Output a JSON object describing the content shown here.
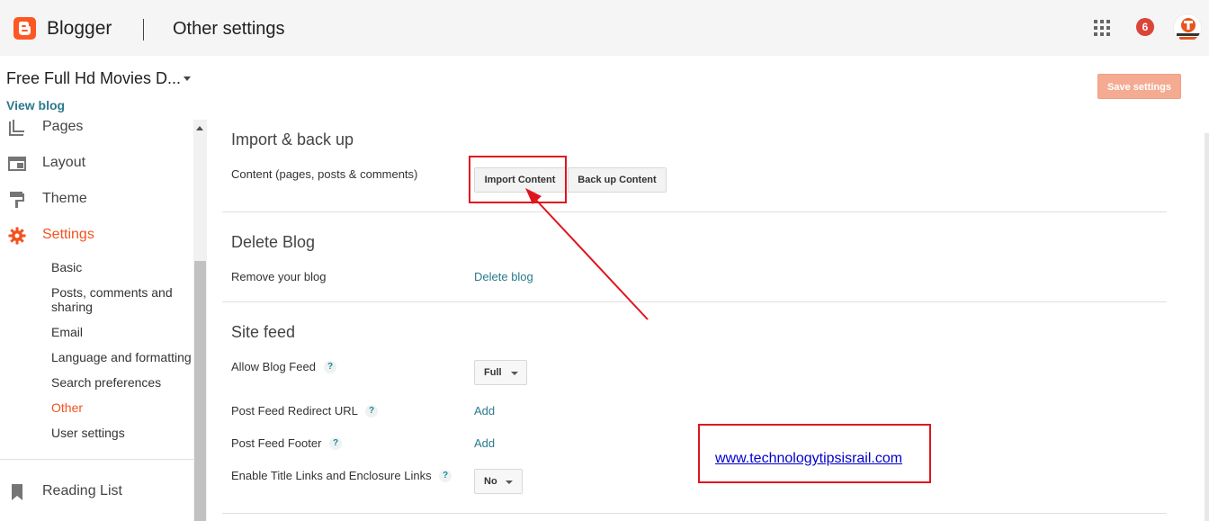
{
  "topbar": {
    "brand": "Blogger",
    "page_heading": "Other settings",
    "notification_count": "6"
  },
  "blog": {
    "title": "Free Full Hd Movies D...",
    "view_blog": "View blog"
  },
  "toolbar": {
    "save_label": "Save settings"
  },
  "sidebar": {
    "items": [
      {
        "label": "Pages",
        "icon": "pages-icon"
      },
      {
        "label": "Layout",
        "icon": "layout-icon"
      },
      {
        "label": "Theme",
        "icon": "theme-icon"
      },
      {
        "label": "Settings",
        "icon": "gear-icon",
        "active": true
      },
      {
        "label": "Reading List",
        "icon": "bookmark-icon"
      }
    ],
    "sub_items": [
      {
        "label": "Basic"
      },
      {
        "label": "Posts, comments and sharing"
      },
      {
        "label": "Email"
      },
      {
        "label": "Language and formatting"
      },
      {
        "label": "Search preferences"
      },
      {
        "label": "Other",
        "active": true
      },
      {
        "label": "User settings"
      }
    ]
  },
  "main": {
    "import_backup": {
      "title": "Import & back up",
      "content_label": "Content (pages, posts & comments)",
      "import_button": "Import Content",
      "backup_button": "Back up Content"
    },
    "delete_blog": {
      "title": "Delete Blog",
      "remove_label": "Remove your blog",
      "delete_link": "Delete blog"
    },
    "site_feed": {
      "title": "Site feed",
      "allow_feed_label": "Allow Blog Feed",
      "allow_feed_value": "Full",
      "redirect_label": "Post Feed Redirect URL",
      "redirect_link": "Add",
      "footer_label": "Post Feed Footer",
      "footer_link": "Add",
      "title_links_label": "Enable Title Links and Enclosure Links",
      "title_links_value": "No",
      "help_symbol": "?"
    }
  },
  "annotation": {
    "watermark_url": "www.technologytipsisrail.com"
  },
  "colors": {
    "accent": "#f4511e",
    "link": "#2a7a8c",
    "annotation_red": "#e0141e",
    "badge": "#db4437"
  }
}
